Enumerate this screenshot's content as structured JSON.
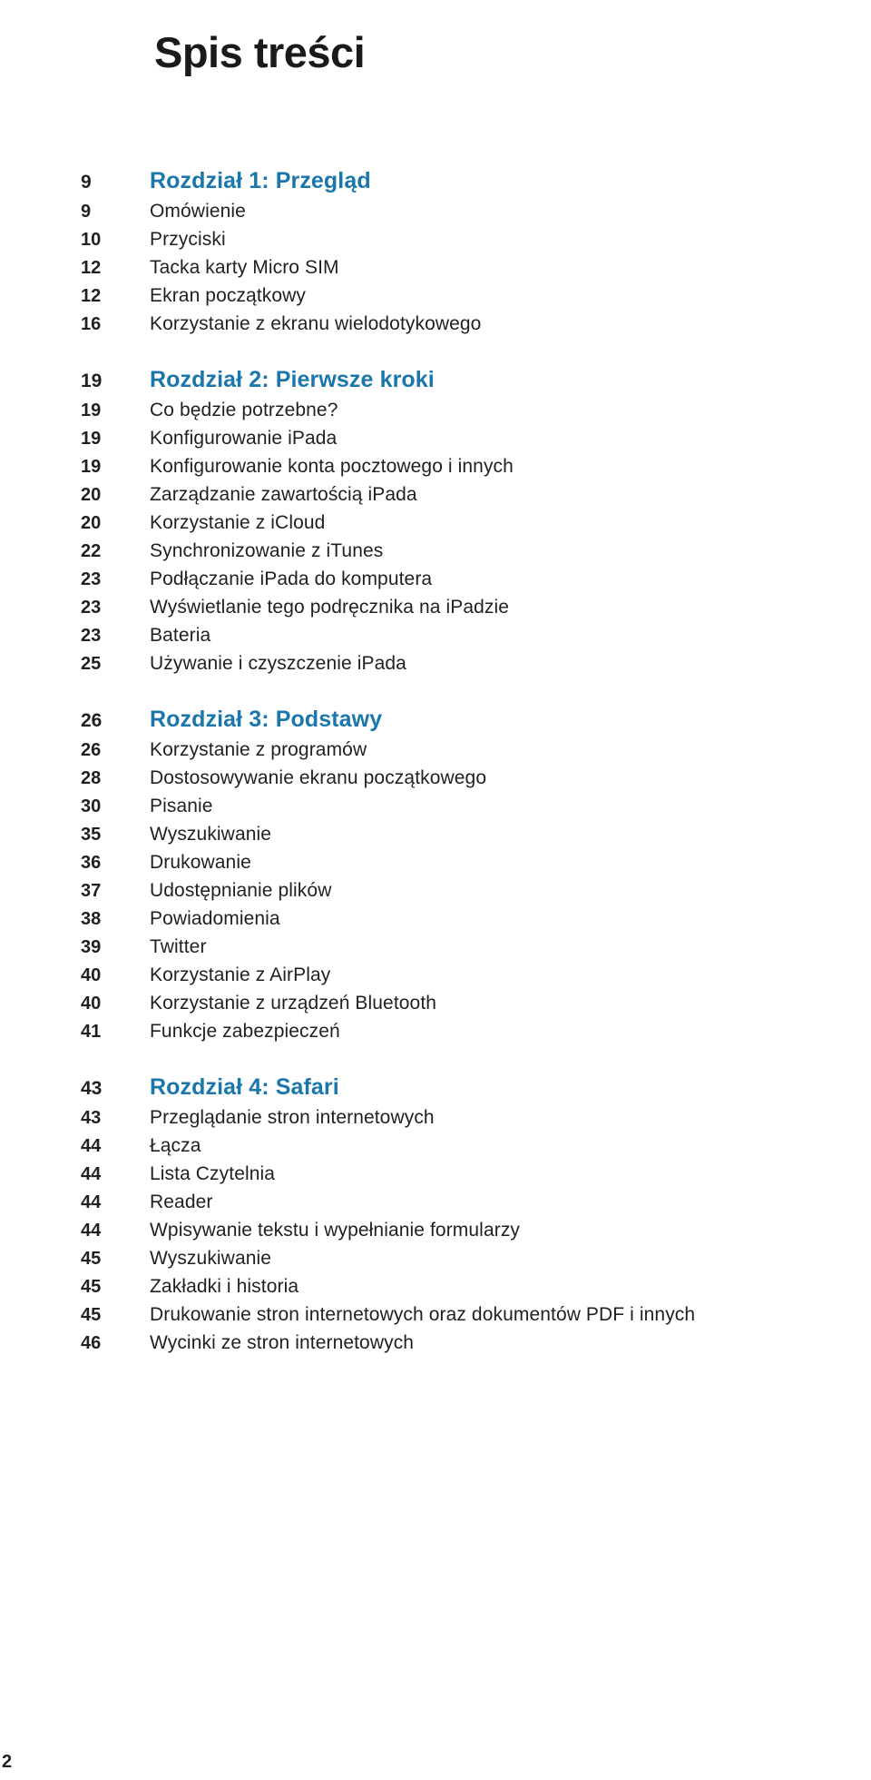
{
  "document": {
    "title": "Spis treści",
    "folio": "2",
    "accent_color": "#1a76ab",
    "text_color": "#231f20",
    "background_color": "#ffffff"
  },
  "toc": {
    "sections": [
      {
        "chapter": {
          "page": "9",
          "label": "Rozdział 1: Przegląd"
        },
        "entries": [
          {
            "page": "9",
            "label": "Omówienie"
          },
          {
            "page": "10",
            "label": "Przyciski"
          },
          {
            "page": "12",
            "label": "Tacka karty Micro SIM"
          },
          {
            "page": "12",
            "label": "Ekran początkowy"
          },
          {
            "page": "16",
            "label": "Korzystanie z ekranu wielodotykowego"
          }
        ]
      },
      {
        "chapter": {
          "page": "19",
          "label": "Rozdział 2: Pierwsze kroki"
        },
        "entries": [
          {
            "page": "19",
            "label": "Co będzie potrzebne?"
          },
          {
            "page": "19",
            "label": "Konfigurowanie iPada"
          },
          {
            "page": "19",
            "label": "Konfigurowanie konta pocztowego i innych"
          },
          {
            "page": "20",
            "label": "Zarządzanie zawartością iPada"
          },
          {
            "page": "20",
            "label": "Korzystanie z iCloud"
          },
          {
            "page": "22",
            "label": "Synchronizowanie z iTunes"
          },
          {
            "page": "23",
            "label": "Podłączanie iPada do komputera"
          },
          {
            "page": "23",
            "label": "Wyświetlanie tego podręcznika na iPadzie"
          },
          {
            "page": "23",
            "label": "Bateria"
          },
          {
            "page": "25",
            "label": "Używanie i czyszczenie iPada"
          }
        ]
      },
      {
        "chapter": {
          "page": "26",
          "label": "Rozdział 3: Podstawy"
        },
        "entries": [
          {
            "page": "26",
            "label": "Korzystanie z programów"
          },
          {
            "page": "28",
            "label": "Dostosowywanie ekranu początkowego"
          },
          {
            "page": "30",
            "label": "Pisanie"
          },
          {
            "page": "35",
            "label": "Wyszukiwanie"
          },
          {
            "page": "36",
            "label": "Drukowanie"
          },
          {
            "page": "37",
            "label": "Udostępnianie plików"
          },
          {
            "page": "38",
            "label": "Powiadomienia"
          },
          {
            "page": "39",
            "label": "Twitter"
          },
          {
            "page": "40",
            "label": "Korzystanie z AirPlay"
          },
          {
            "page": "40",
            "label": "Korzystanie z urządzeń Bluetooth"
          },
          {
            "page": "41",
            "label": "Funkcje zabezpieczeń"
          }
        ]
      },
      {
        "chapter": {
          "page": "43",
          "label": "Rozdział 4: Safari"
        },
        "entries": [
          {
            "page": "43",
            "label": "Przeglądanie stron internetowych"
          },
          {
            "page": "44",
            "label": "Łącza"
          },
          {
            "page": "44",
            "label": "Lista Czytelnia"
          },
          {
            "page": "44",
            "label": "Reader"
          },
          {
            "page": "44",
            "label": "Wpisywanie tekstu i wypełnianie formularzy"
          },
          {
            "page": "45",
            "label": "Wyszukiwanie"
          },
          {
            "page": "45",
            "label": "Zakładki i historia"
          },
          {
            "page": "45",
            "label": "Drukowanie stron internetowych oraz dokumentów PDF i innych"
          },
          {
            "page": "46",
            "label": "Wycinki ze stron internetowych"
          }
        ]
      }
    ]
  }
}
